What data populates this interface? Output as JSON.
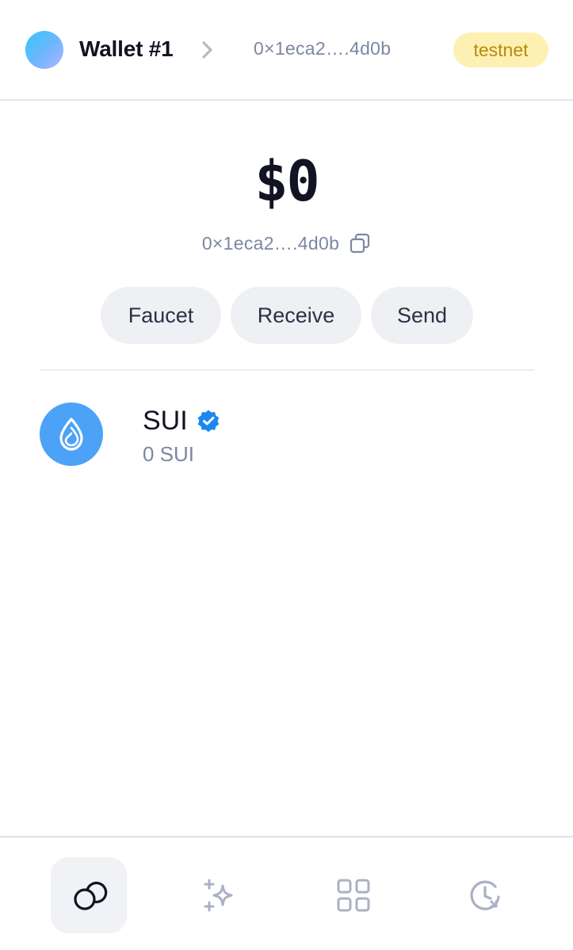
{
  "header": {
    "wallet_name": "Wallet #1",
    "address": "0×1eca2….4d0b",
    "network_badge": "testnet"
  },
  "balance": {
    "value": "$0",
    "address": "0×1eca2….4d0b"
  },
  "actions": {
    "faucet": "Faucet",
    "receive": "Receive",
    "send": "Send"
  },
  "tokens": [
    {
      "name": "SUI",
      "amount": "0 SUI",
      "verified": true,
      "icon": "sui-drop-icon"
    }
  ],
  "nav": [
    {
      "icon": "coins-icon",
      "active": true
    },
    {
      "icon": "sparkles-icon",
      "active": false
    },
    {
      "icon": "apps-grid-icon",
      "active": false
    },
    {
      "icon": "history-clock-icon",
      "active": false
    }
  ],
  "colors": {
    "accent": "#4ca2f7",
    "badge_bg": "#fdf0b3",
    "badge_text": "#b88a0a",
    "muted_text": "#7d86a3",
    "button_bg": "#eff0f3"
  }
}
